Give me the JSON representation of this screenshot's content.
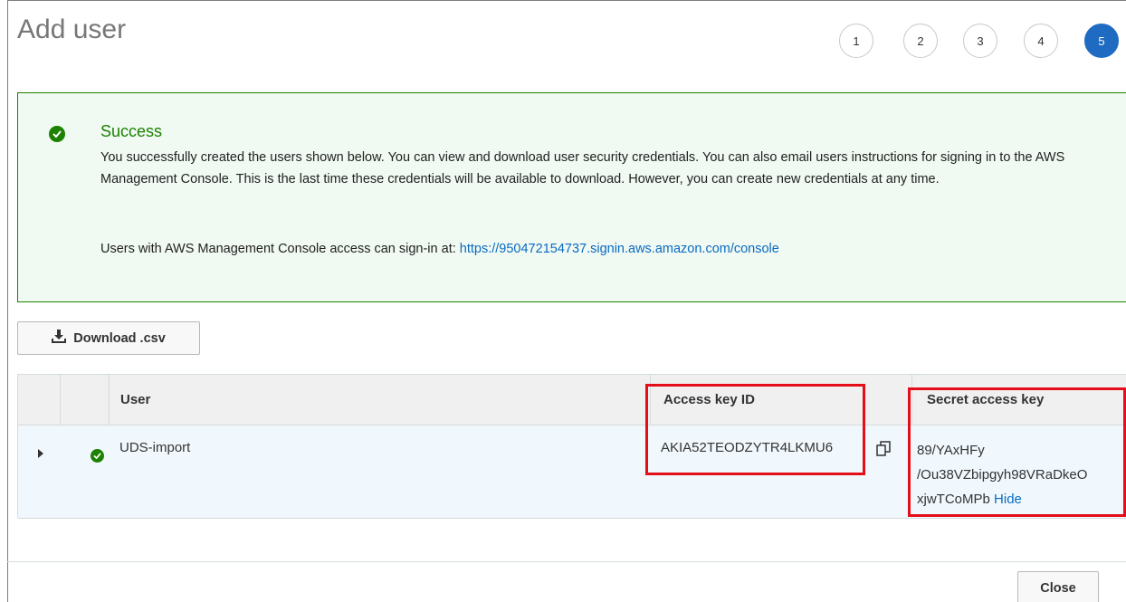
{
  "dialog": {
    "title": "Add user",
    "steps": [
      "1",
      "2",
      "3",
      "4",
      "5"
    ],
    "active_step": "5"
  },
  "alert": {
    "title": "Success",
    "body": "You successfully created the users shown below. You can view and download user security credentials. You can also email users instructions for signing in to the AWS Management Console. This is the last time these credentials will be available to download. However, you can create new credentials at any time.",
    "signin_prefix": "Users with AWS Management Console access can sign-in at: ",
    "signin_url": "https://950472154737.signin.aws.amazon.com/console",
    "icon": "check-circle-icon",
    "color": "#1d8102"
  },
  "toolbar": {
    "download_label": "Download .csv",
    "download_icon": "download-icon"
  },
  "table": {
    "columns": [
      "User",
      "Access key ID",
      "Secret access key"
    ],
    "rows": [
      {
        "user": "UDS-import",
        "access_key_id": "AKIA52TEODZYTR4LKMU6",
        "secret_line1": "89/YAxHFy",
        "secret_line2": "/Ou38VZbipgyh98VRaDkeO",
        "secret_line3": "xjwTCoMPb",
        "hide_label": "Hide",
        "status_icon": "check-circle-icon"
      }
    ]
  },
  "footer": {
    "close_label": "Close"
  },
  "highlight_color": "#e30e19",
  "accent_color": "#1f6bc2"
}
